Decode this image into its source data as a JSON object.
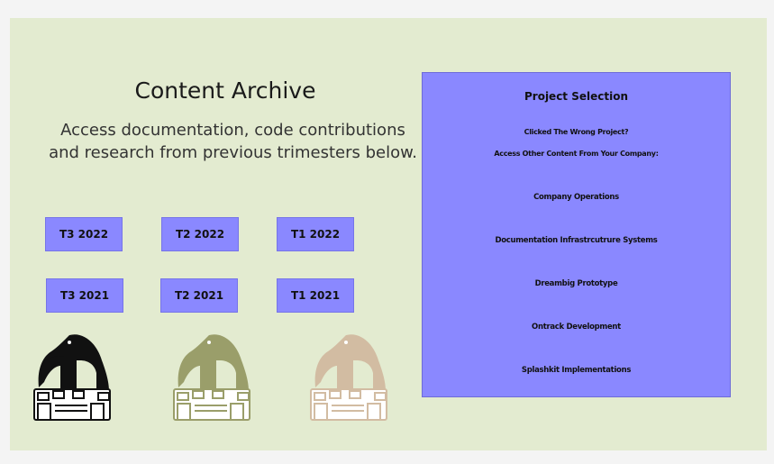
{
  "archive": {
    "title": "Content Archive",
    "subtitle": "Access documentation, code contributions and research from previous trimesters below."
  },
  "trimesters": [
    "T3 2022",
    "T2 2022",
    "T1 2022",
    "T3 2021",
    "T2 2021",
    "T1 2021"
  ],
  "project_selection": {
    "heading": "Project Selection",
    "line1": "Clicked The Wrong Project?",
    "line2": "Access Other Content From Your Company:",
    "projects": [
      "Company Operations",
      "Documentation Infrastrcutrure Systems",
      "Dreambig Prototype",
      "Ontrack Development",
      "Splashkit Implementations"
    ]
  },
  "mascot_colors": [
    "#111111",
    "#9a9e6a",
    "#d2bca2"
  ],
  "colors": {
    "panel_bg": "#e3ebd0",
    "accent": "#8a88ff"
  }
}
